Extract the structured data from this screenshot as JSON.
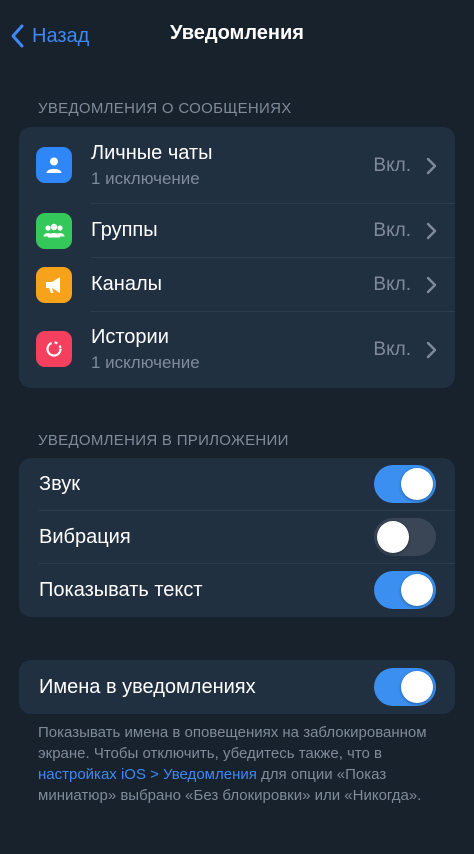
{
  "colors": {
    "background": "#18222d",
    "card": "#213040",
    "accent": "#3e88f7",
    "secondary_text": "#7f8b9a",
    "toggle_on": "#3b8ff0",
    "toggle_off": "#3a4656"
  },
  "nav": {
    "back_label": "Назад",
    "title": "Уведомления"
  },
  "message_notifications": {
    "header": "УВЕДОМЛЕНИЯ О СООБЩЕНИЯХ",
    "items": [
      {
        "title": "Личные чаты",
        "subtitle": "1 исключение",
        "value": "Вкл.",
        "icon": "person-icon",
        "color": "#2f86f7"
      },
      {
        "title": "Группы",
        "subtitle": "",
        "value": "Вкл.",
        "icon": "group-icon",
        "color": "#34c759"
      },
      {
        "title": "Каналы",
        "subtitle": "",
        "value": "Вкл.",
        "icon": "megaphone-icon",
        "color": "#f7a21b"
      },
      {
        "title": "Истории",
        "subtitle": "1 исключение",
        "value": "Вкл.",
        "icon": "stories-icon",
        "color": "#f43f5e"
      }
    ]
  },
  "in_app": {
    "header": "УВЕДОМЛЕНИЯ В ПРИЛОЖЕНИИ",
    "items": [
      {
        "label": "Звук",
        "on": true
      },
      {
        "label": "Вибрация",
        "on": false
      },
      {
        "label": "Показывать текст",
        "on": true
      }
    ]
  },
  "names": {
    "label": "Имена в уведомлениях",
    "on": true,
    "footer_part1": "Показывать имена в оповещениях на заблокированном экране. Чтобы отключить, убедитесь также, что в ",
    "footer_link": "настройках iOS > Уведомления",
    "footer_part2": " для опции «Показ миниатюр» выбрано «Без блокировки» или «Никогда»."
  }
}
